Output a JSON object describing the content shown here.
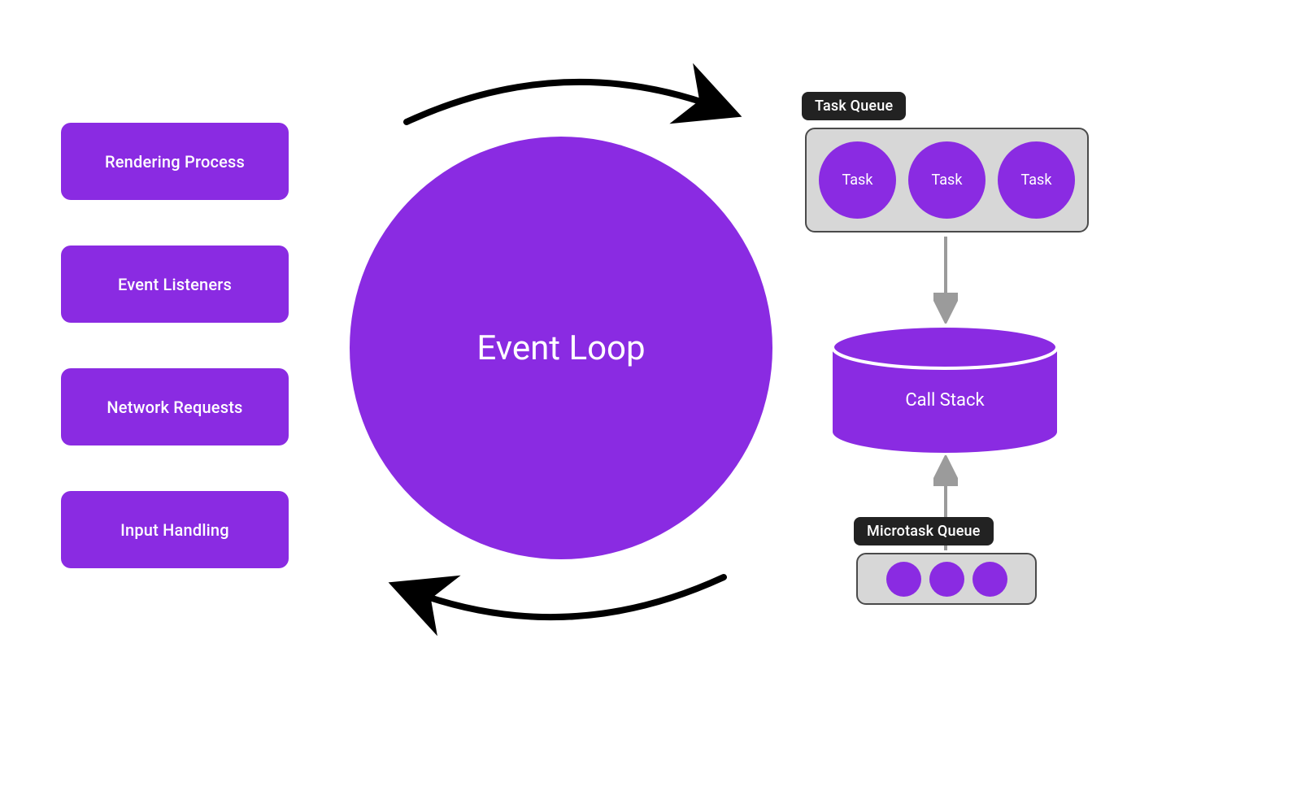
{
  "left_cards": [
    {
      "label": "Rendering Process"
    },
    {
      "label": "Event Listeners"
    },
    {
      "label": "Network Requests"
    },
    {
      "label": "Input Handling"
    }
  ],
  "center": {
    "title": "Event Loop"
  },
  "task_queue": {
    "label": "Task Queue",
    "items": [
      "Task",
      "Task",
      "Task"
    ]
  },
  "call_stack": {
    "label": "Call Stack"
  },
  "microtask_queue": {
    "label": "Microtask Queue",
    "count": 3
  },
  "colors": {
    "purple": "#8a2be2",
    "light_gray": "#d7d7d7",
    "dark": "#222222",
    "arrow_gray": "#9b9b9b"
  }
}
